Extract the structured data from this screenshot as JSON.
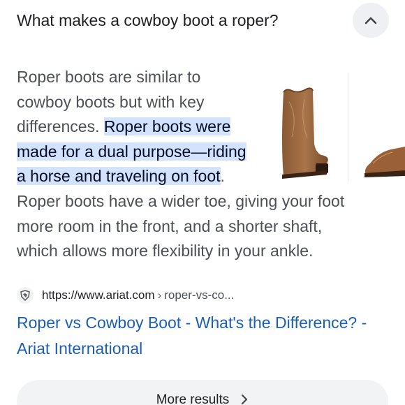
{
  "question": {
    "title": "What makes a cowboy boot a roper?",
    "collapse_icon": "chevron-up-icon"
  },
  "answer": {
    "line1": "Roper boots are similar to",
    "line2": "cowboy boots but with key",
    "line3_plain": "differences. ",
    "line3_hl": "Roper boots were",
    "line4_hl": "made for a dual purpose—riding",
    "line5_hl": "a horse and traveling on foot",
    "line5_plain": ".",
    "line6": "Roper boots have a wider toe, giving your foot",
    "line7": "more room in the front, and a shorter shaft,",
    "line8": "which allows more flexibility in your ankle."
  },
  "images": {
    "main": "brown-roper-boot-image",
    "secondary": "boot-toe-image"
  },
  "source": {
    "favicon": "ariat-horse-logo-icon",
    "domain": "https://www.ariat.com",
    "separator": "›",
    "path": "roper-vs-co..."
  },
  "result": {
    "title_line1": "Roper vs Cowboy Boot - What's the Difference? -",
    "title_line2": "Ariat International"
  },
  "more": {
    "label": "More results",
    "icon": "chevron-right-icon"
  },
  "colors": {
    "highlight": "#d3e3fd",
    "link": "#1a5fb4",
    "text": "#4d5156",
    "heading": "#202124"
  }
}
